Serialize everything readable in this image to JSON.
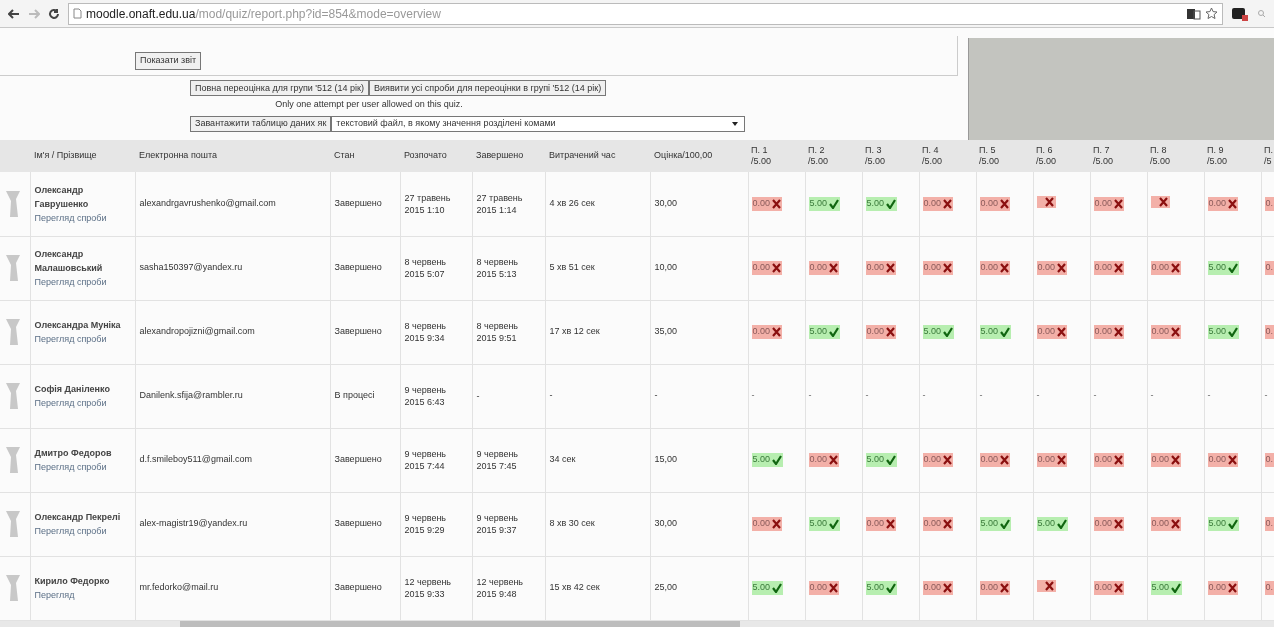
{
  "browser": {
    "url_host": "moodle.onaft.edu.ua",
    "url_path": "/mod/quiz/report.php?id=854&mode=overview"
  },
  "show_report_button": "Показати звіт",
  "regrade_buttons": [
    "Повна переоцінка для групи '512 (14 рік)",
    "Виявити усі спроби для переоцінки в групі '512 (14 рік)"
  ],
  "attempt_note": "Only one attempt per user allowed on this quiz.",
  "download": {
    "button": "Завантажити таблицю даних як",
    "format": "текстовий файл, в якому значення розділені комами"
  },
  "table": {
    "columns": [
      "Ім'я / Прізвище",
      "Електронна пошта",
      "Стан",
      "Розпочато",
      "Завершено",
      "Витрачений час",
      "Оцінка/100,00"
    ],
    "question_columns": [
      {
        "label": "П. 1",
        "max": "/5.00"
      },
      {
        "label": "П. 2",
        "max": "/5.00"
      },
      {
        "label": "П. 3",
        "max": "/5.00"
      },
      {
        "label": "П. 4",
        "max": "/5.00"
      },
      {
        "label": "П. 5",
        "max": "/5.00"
      },
      {
        "label": "П. 6",
        "max": "/5.00"
      },
      {
        "label": "П. 7",
        "max": "/5.00"
      },
      {
        "label": "П. 8",
        "max": "/5.00"
      },
      {
        "label": "П. 9",
        "max": "/5.00"
      },
      {
        "label": "П.",
        "max": "/5"
      }
    ],
    "rows": [
      {
        "name": "Олександр Гаврушенко",
        "review": "Перегляд спроби",
        "email": "alexandrgavrushenko@gmail.com",
        "state": "Завершено",
        "started": "27 травень 2015 1:10",
        "finished": "27 травень 2015 1:14",
        "time": "4 хв 26 сек",
        "grade": "30,00",
        "questions": [
          {
            "kind": "incorrect",
            "text": "0.00"
          },
          {
            "kind": "correct",
            "text": "5.00"
          },
          {
            "kind": "correct",
            "text": "5.00"
          },
          {
            "kind": "incorrect",
            "text": "0.00"
          },
          {
            "kind": "incorrect",
            "text": "0.00"
          },
          {
            "kind": "blank"
          },
          {
            "kind": "incorrect",
            "text": "0.00"
          },
          {
            "kind": "blank"
          },
          {
            "kind": "incorrect",
            "text": "0.00"
          },
          {
            "kind": "partial",
            "text": "0."
          }
        ]
      },
      {
        "name": "Олександр Малашовський",
        "review": "Перегляд спроби",
        "email": "sasha150397@yandex.ru",
        "state": "Завершено",
        "started": "8 червень 2015 5:07",
        "finished": "8 червень 2015 5:13",
        "time": "5 хв 51 сек",
        "grade": "10,00",
        "questions": [
          {
            "kind": "incorrect",
            "text": "0.00"
          },
          {
            "kind": "incorrect",
            "text": "0.00"
          },
          {
            "kind": "incorrect",
            "text": "0.00"
          },
          {
            "kind": "incorrect",
            "text": "0.00"
          },
          {
            "kind": "incorrect",
            "text": "0.00"
          },
          {
            "kind": "incorrect",
            "text": "0.00"
          },
          {
            "kind": "incorrect",
            "text": "0.00"
          },
          {
            "kind": "incorrect",
            "text": "0.00"
          },
          {
            "kind": "correct",
            "text": "5.00"
          },
          {
            "kind": "partial",
            "text": "0."
          }
        ]
      },
      {
        "name": "Олександра Муніка",
        "review": "Перегляд спроби",
        "email": "alexandropojizni@gmail.com",
        "state": "Завершено",
        "started": "8 червень 2015 9:34",
        "finished": "8 червень 2015 9:51",
        "time": "17 хв 12 сек",
        "grade": "35,00",
        "questions": [
          {
            "kind": "incorrect",
            "text": "0.00"
          },
          {
            "kind": "correct",
            "text": "5.00"
          },
          {
            "kind": "incorrect",
            "text": "0.00"
          },
          {
            "kind": "correct",
            "text": "5.00"
          },
          {
            "kind": "correct",
            "text": "5.00"
          },
          {
            "kind": "incorrect",
            "text": "0.00"
          },
          {
            "kind": "incorrect",
            "text": "0.00"
          },
          {
            "kind": "incorrect",
            "text": "0.00"
          },
          {
            "kind": "correct",
            "text": "5.00"
          },
          {
            "kind": "partial",
            "text": "0."
          }
        ]
      },
      {
        "name": "Софія Даніленко",
        "review": "Перегляд спроби",
        "email": "Danilenk.sfija@rambler.ru",
        "state": "В процесі",
        "started": "9 червень 2015 6:43",
        "finished": "-",
        "time": "-",
        "grade": "-",
        "questions": [
          {
            "kind": "dash",
            "text": "-"
          },
          {
            "kind": "dash",
            "text": "-"
          },
          {
            "kind": "dash",
            "text": "-"
          },
          {
            "kind": "dash",
            "text": "-"
          },
          {
            "kind": "dash",
            "text": "-"
          },
          {
            "kind": "dash",
            "text": "-"
          },
          {
            "kind": "dash",
            "text": "-"
          },
          {
            "kind": "dash",
            "text": "-"
          },
          {
            "kind": "dash",
            "text": "-"
          },
          {
            "kind": "dash",
            "text": "-"
          }
        ]
      },
      {
        "name": "Дмитро Федоров",
        "review": "Перегляд спроби",
        "email": "d.f.smileboy511@gmail.com",
        "state": "Завершено",
        "started": "9 червень 2015 7:44",
        "finished": "9 червень 2015 7:45",
        "time": "34 сек",
        "grade": "15,00",
        "questions": [
          {
            "kind": "correct",
            "text": "5.00"
          },
          {
            "kind": "incorrect",
            "text": "0.00"
          },
          {
            "kind": "correct",
            "text": "5.00"
          },
          {
            "kind": "incorrect",
            "text": "0.00"
          },
          {
            "kind": "incorrect",
            "text": "0.00"
          },
          {
            "kind": "incorrect",
            "text": "0.00"
          },
          {
            "kind": "incorrect",
            "text": "0.00"
          },
          {
            "kind": "incorrect",
            "text": "0.00"
          },
          {
            "kind": "incorrect",
            "text": "0.00"
          },
          {
            "kind": "partial",
            "text": "0."
          }
        ]
      },
      {
        "name": "Олександр Пекрелі",
        "review": "Перегляд спроби",
        "email": "alex-magistr19@yandex.ru",
        "state": "Завершено",
        "started": "9 червень 2015 9:29",
        "finished": "9 червень 2015 9:37",
        "time": "8 хв 30 сек",
        "grade": "30,00",
        "questions": [
          {
            "kind": "incorrect",
            "text": "0.00"
          },
          {
            "kind": "correct",
            "text": "5.00"
          },
          {
            "kind": "incorrect",
            "text": "0.00"
          },
          {
            "kind": "incorrect",
            "text": "0.00"
          },
          {
            "kind": "correct",
            "text": "5.00"
          },
          {
            "kind": "correct",
            "text": "5.00"
          },
          {
            "kind": "incorrect",
            "text": "0.00"
          },
          {
            "kind": "incorrect",
            "text": "0.00"
          },
          {
            "kind": "correct",
            "text": "5.00"
          },
          {
            "kind": "partial",
            "text": "0."
          }
        ]
      },
      {
        "name": "Кирило Федорко",
        "review": "Перегляд",
        "email": "mr.fedorko@mail.ru",
        "state": "Завершено",
        "started": "12 червень 2015 9:33",
        "finished": "12 червень 2015 9:48",
        "time": "15 хв 42 сек",
        "grade": "25,00",
        "questions": [
          {
            "kind": "correct",
            "text": "5.00"
          },
          {
            "kind": "incorrect",
            "text": "0.00"
          },
          {
            "kind": "correct",
            "text": "5.00"
          },
          {
            "kind": "incorrect",
            "text": "0.00"
          },
          {
            "kind": "incorrect",
            "text": "0.00"
          },
          {
            "kind": "blank"
          },
          {
            "kind": "incorrect",
            "text": "0.00"
          },
          {
            "kind": "correct",
            "text": "5.00"
          },
          {
            "kind": "incorrect",
            "text": "0.00"
          },
          {
            "kind": "partial",
            "text": "0."
          }
        ]
      }
    ]
  }
}
